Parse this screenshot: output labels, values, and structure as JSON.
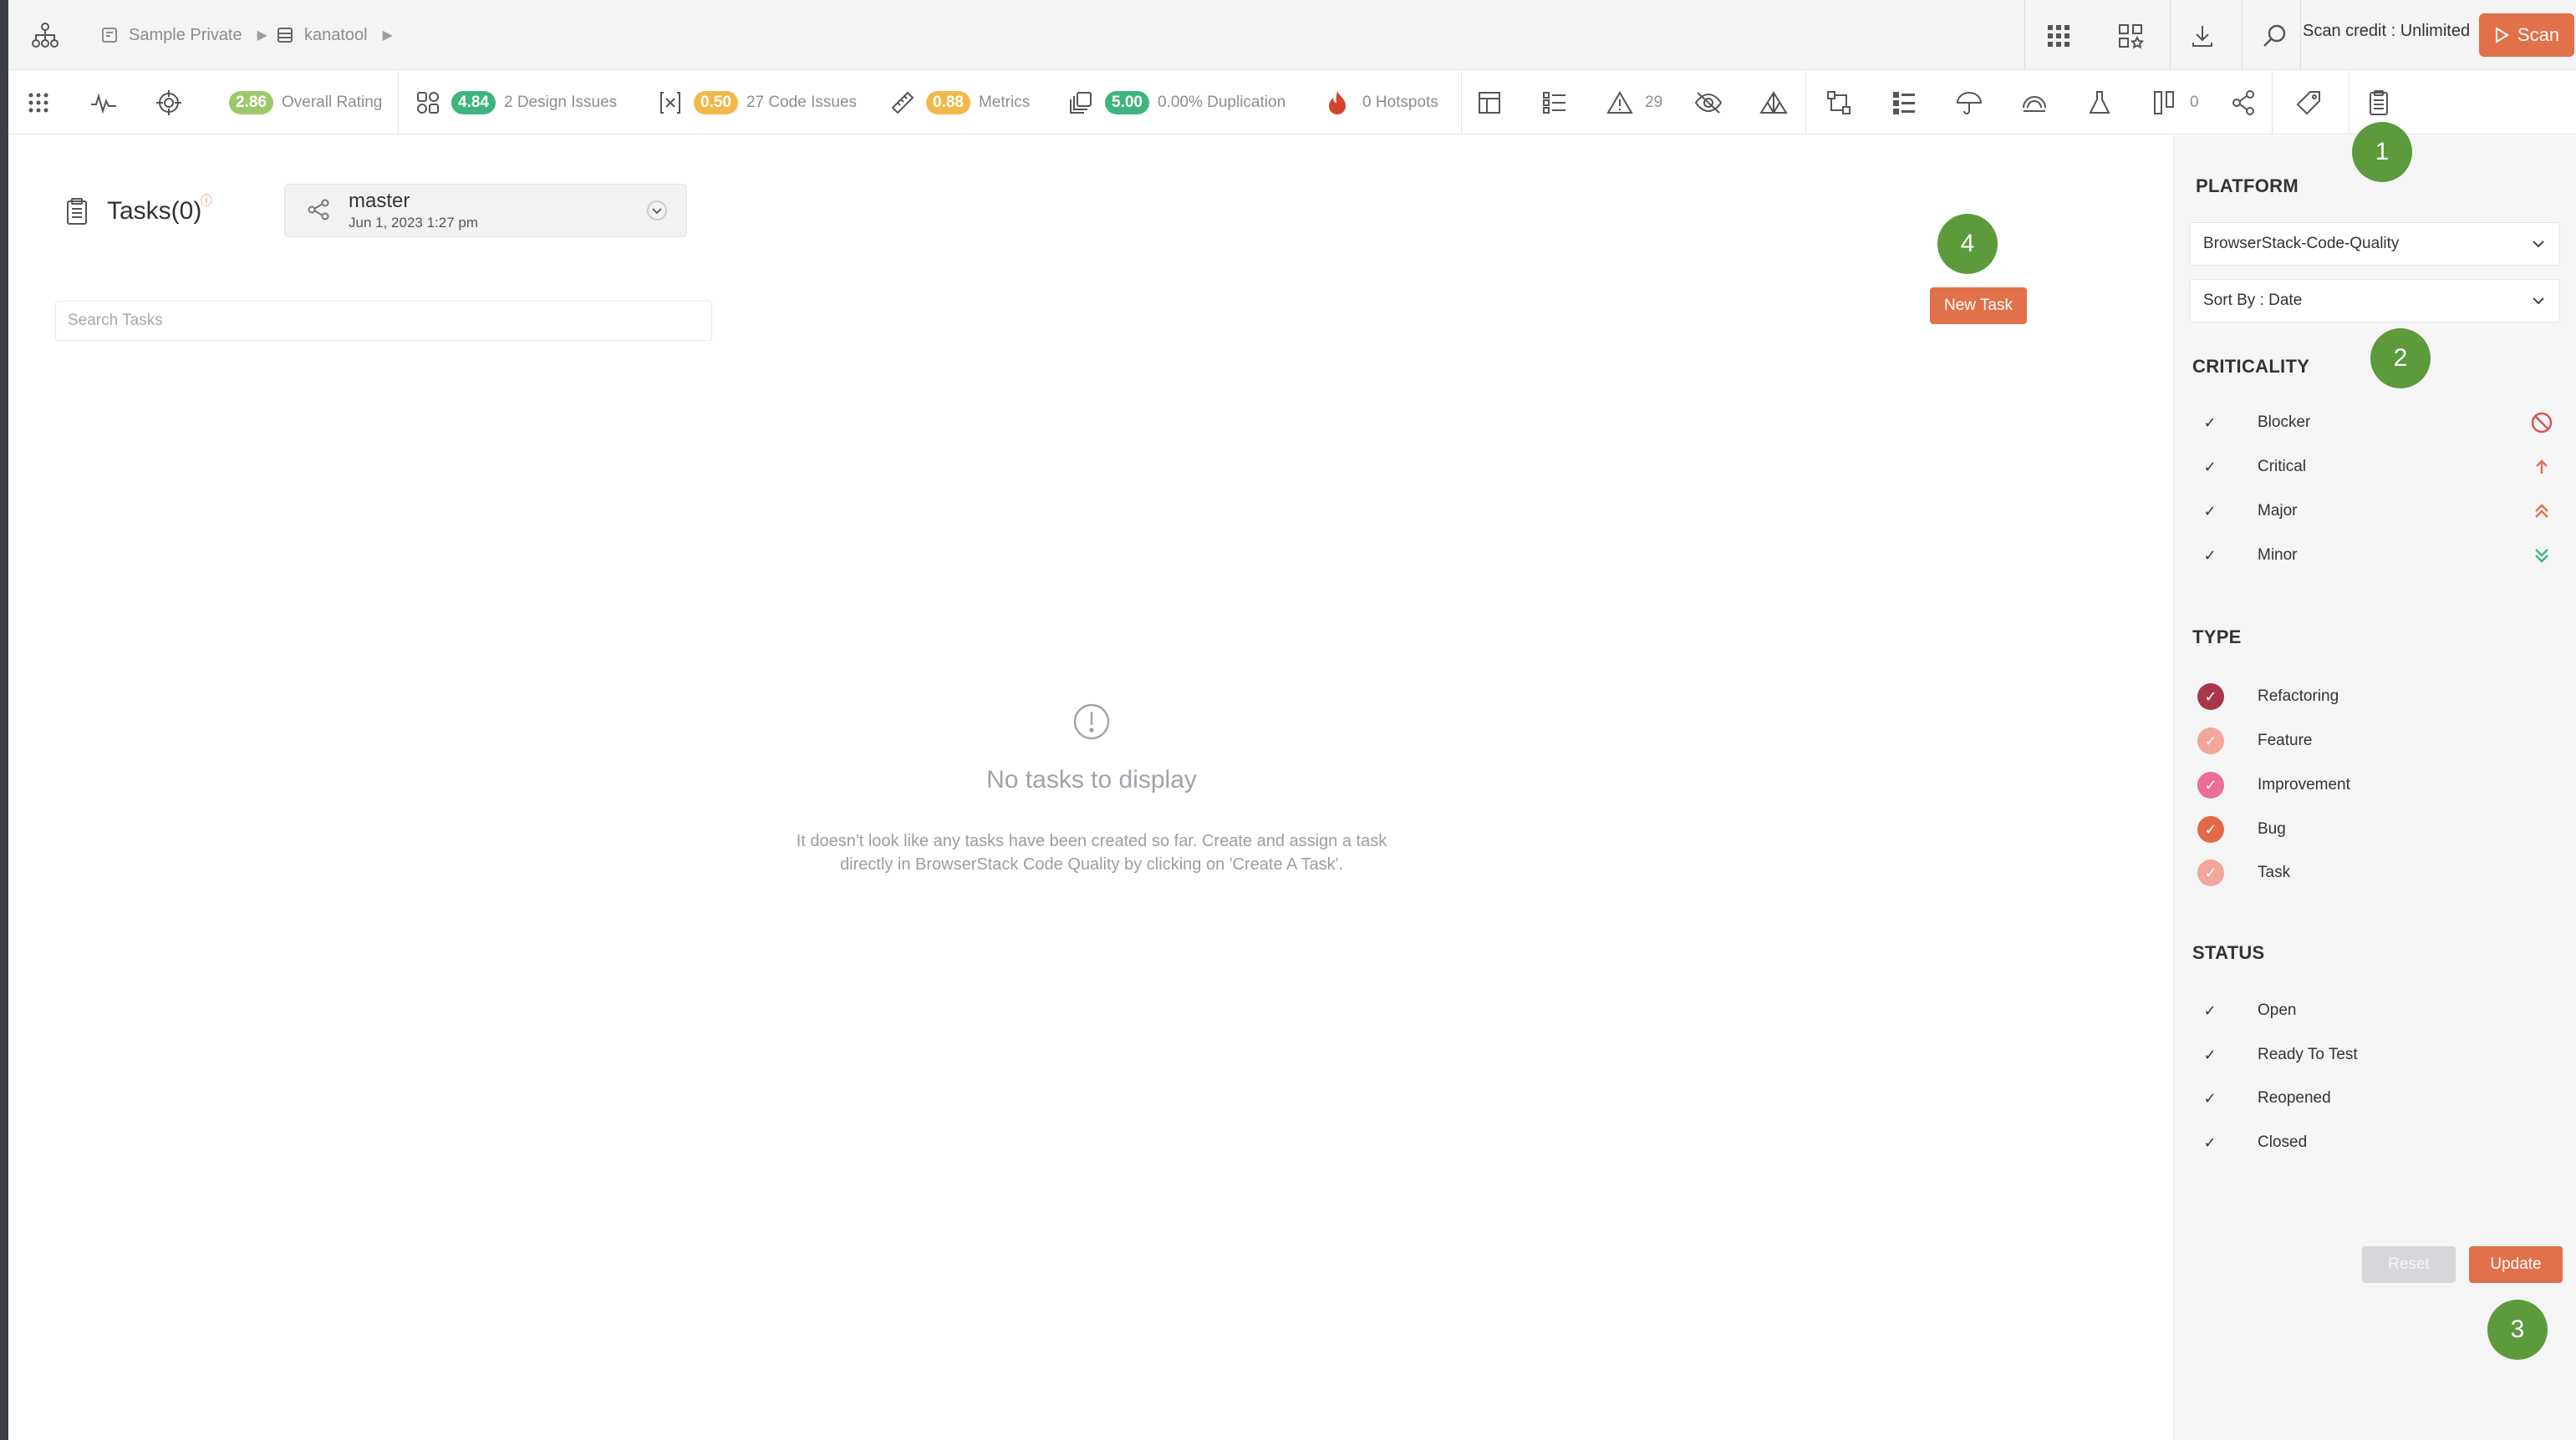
{
  "topbar": {
    "breadcrumbs": [
      "Sample Private",
      "kanatool"
    ],
    "scan_credit": "Scan credit : Unlimited",
    "scan_label": "Scan"
  },
  "metrics": {
    "overall_rating": {
      "value": "2.86",
      "label": "Overall Rating",
      "color": "#9cc96b"
    },
    "design_issues": {
      "value": "4.84",
      "label": "2 Design Issues",
      "color": "#3fb47c"
    },
    "code_issues": {
      "value": "0.50",
      "label": "27 Code Issues",
      "color": "#f2b84b"
    },
    "metrics": {
      "value": "0.88",
      "label": "Metrics",
      "color": "#f2b84b"
    },
    "duplication": {
      "value": "5.00",
      "label": "0.00% Duplication",
      "color": "#3fb47c"
    },
    "hotspots": {
      "label": "0 Hotspots"
    },
    "warnings_count": "29",
    "branches_count": "0"
  },
  "main": {
    "title": "Tasks(0)",
    "info_mark": "ⓘ",
    "branch_name": "master",
    "branch_date": "Jun 1, 2023   1:27 pm",
    "search_placeholder": "Search Tasks",
    "new_task_label": "New Task",
    "empty_title": "No tasks to display",
    "empty_text": "It doesn't look like any tasks have been created so far. Create and assign a task directly in BrowserStack Code Quality by clicking on 'Create A Task'."
  },
  "panel": {
    "platform_heading": "PLATFORM",
    "platform_value": "BrowserStack-Code-Quality",
    "sort_value": "Sort By : Date",
    "criticality_heading": "CRITICALITY",
    "criticality": [
      {
        "label": "Blocker",
        "icon": "blocker-icon",
        "color": "#d9534f"
      },
      {
        "label": "Critical",
        "icon": "arrow-up-icon",
        "color": "#e0714a"
      },
      {
        "label": "Major",
        "icon": "double-chevron-up-icon",
        "color": "#e0714a"
      },
      {
        "label": "Minor",
        "icon": "double-chevron-down-icon",
        "color": "#3fb47c"
      }
    ],
    "type_heading": "TYPE",
    "types": [
      {
        "label": "Refactoring",
        "color": "#a8374a"
      },
      {
        "label": "Feature",
        "color": "#f2a79a"
      },
      {
        "label": "Improvement",
        "color": "#ea6e95"
      },
      {
        "label": "Bug",
        "color": "#e26a48"
      },
      {
        "label": "Task",
        "color": "#f2a79a"
      }
    ],
    "status_heading": "STATUS",
    "statuses": [
      "Open",
      "Ready To Test",
      "Reopened",
      "Closed"
    ],
    "reset_label": "Reset",
    "update_label": "Update"
  },
  "annotations": [
    "1",
    "2",
    "3",
    "4"
  ]
}
